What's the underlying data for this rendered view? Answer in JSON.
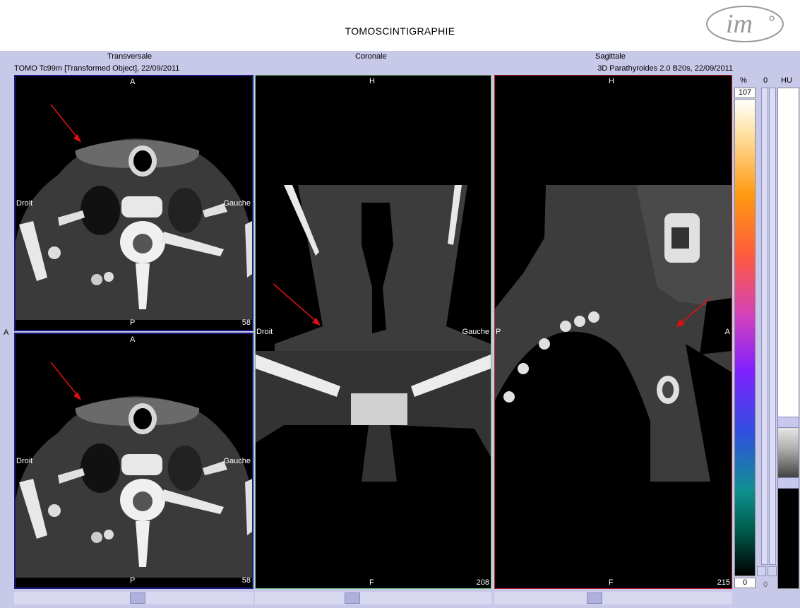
{
  "app": {
    "title": "TOMOSCINTIGRAPHIE",
    "logo_text": "im"
  },
  "views": {
    "transverse": {
      "name": "Transversale",
      "info": "TOMO Tc99m [Transformed Object], 22/09/2011"
    },
    "coronal": {
      "name": "Coronale"
    },
    "sagittal": {
      "name": "Sagittale",
      "info": "3D Parathyroides  2.0  B20s, 22/09/2011"
    }
  },
  "side_marker": "A",
  "panels": {
    "transverse_top": {
      "top": "A",
      "bottom": "P",
      "left": "Droit",
      "right": "Gauche",
      "slice": "58"
    },
    "transverse_bottom": {
      "top": "A",
      "bottom": "P",
      "left": "Droit",
      "right": "Gauche",
      "slice": "58"
    },
    "coronal": {
      "top": "H",
      "bottom": "F",
      "left": "Droit",
      "right": "Gauche",
      "slice": "208"
    },
    "sagittal": {
      "top": "H",
      "bottom": "F",
      "left": "P",
      "right": "A",
      "slice": "215"
    }
  },
  "colorbar": {
    "unit": "%",
    "max": "107",
    "min": "0"
  },
  "hu_bar": {
    "unit": "HU",
    "top_value": "0",
    "bottom_value": "0"
  },
  "colors": {
    "transverse_border": "#1a1a80",
    "coronal_border": "#70c070",
    "sagittal_border": "#c02020",
    "arrow": "#e01010"
  }
}
